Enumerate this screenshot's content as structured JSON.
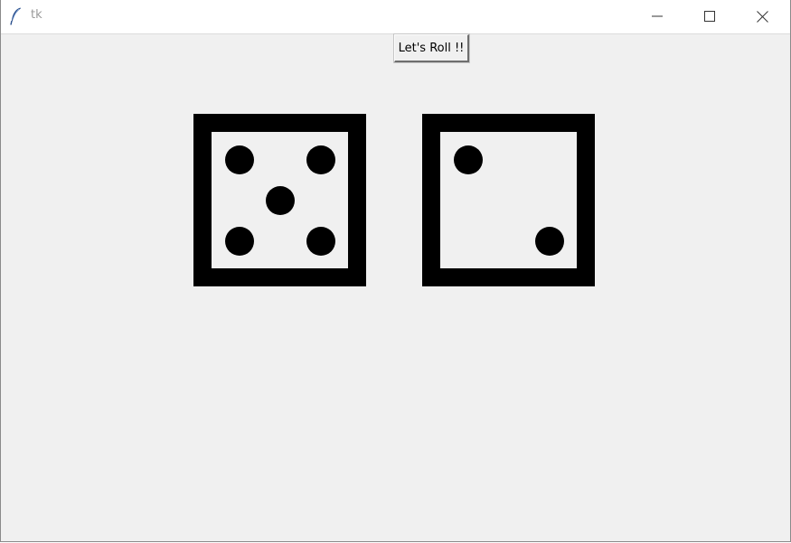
{
  "window": {
    "title": "tk"
  },
  "titlebar_buttons": {
    "minimize_icon": "minimize-icon",
    "maximize_icon": "maximize-icon",
    "close_icon": "close-icon"
  },
  "app": {
    "roll_button_label": "Let's Roll !!"
  },
  "dice": [
    {
      "value": 5
    },
    {
      "value": 2
    }
  ],
  "colors": {
    "client_background": "#f0f0f0",
    "die_border": "#000000",
    "pip": "#000000"
  }
}
